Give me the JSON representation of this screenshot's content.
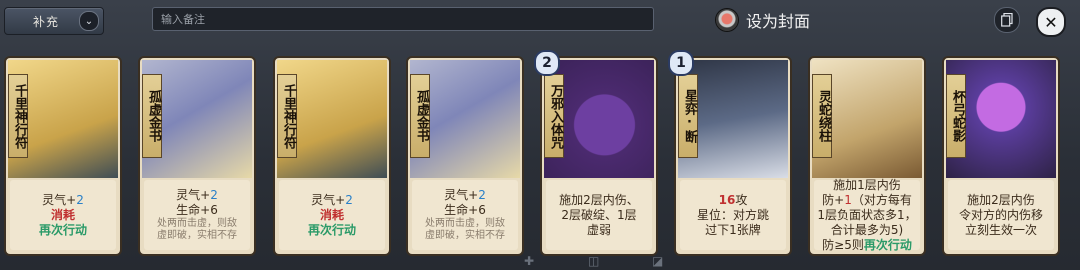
{
  "topbar": {
    "supplement_label": "补充",
    "note_placeholder": "输入备注",
    "cover_label": "设为封面"
  },
  "cards": [
    {
      "name": "千里神行符",
      "lines": [
        [
          {
            "t": "灵气+",
            "c": ""
          },
          {
            "t": "2",
            "c": "c-blue"
          }
        ],
        [
          {
            "t": "消耗",
            "c": "c-red hl"
          }
        ],
        [
          {
            "t": "再次行动",
            "c": "c-green hl"
          }
        ]
      ]
    },
    {
      "name": "孤虚金书",
      "lines": [
        [
          {
            "t": "灵气+",
            "c": ""
          },
          {
            "t": "2",
            "c": "c-blue"
          }
        ],
        [
          {
            "t": "生命+6",
            "c": ""
          }
        ],
        [
          {
            "t": "处两而击虚，则敌",
            "c": "small"
          }
        ],
        [
          {
            "t": "虚即破，实相不存",
            "c": "small"
          }
        ]
      ]
    },
    {
      "name": "千里神行符",
      "lines": [
        [
          {
            "t": "灵气+",
            "c": ""
          },
          {
            "t": "2",
            "c": "c-blue"
          }
        ],
        [
          {
            "t": "消耗",
            "c": "c-red hl"
          }
        ],
        [
          {
            "t": "再次行动",
            "c": "c-green hl"
          }
        ]
      ]
    },
    {
      "name": "孤虚金书",
      "lines": [
        [
          {
            "t": "灵气+",
            "c": ""
          },
          {
            "t": "2",
            "c": "c-blue"
          }
        ],
        [
          {
            "t": "生命+6",
            "c": ""
          }
        ],
        [
          {
            "t": "处两而击虚，则敌",
            "c": "small"
          }
        ],
        [
          {
            "t": "虚即破，实相不存",
            "c": "small"
          }
        ]
      ]
    },
    {
      "name": "万邪入体咒",
      "cost": "2",
      "lines": [
        [
          {
            "t": "施加2层内伤、",
            "c": ""
          }
        ],
        [
          {
            "t": "2层破绽、1层",
            "c": ""
          }
        ],
        [
          {
            "t": "虚弱",
            "c": ""
          }
        ]
      ]
    },
    {
      "name": "星弈·断",
      "cost": "1",
      "lines": [
        [
          {
            "t": "16",
            "c": "c-red hl"
          },
          {
            "t": "攻",
            "c": ""
          }
        ],
        [
          {
            "t": "星位：对方跳",
            "c": ""
          }
        ],
        [
          {
            "t": "过下1张牌",
            "c": ""
          }
        ]
      ]
    },
    {
      "name": "灵蛇绕柱",
      "lines": [
        [
          {
            "t": "施加1层内伤",
            "c": ""
          }
        ],
        [
          {
            "t": "防+",
            "c": ""
          },
          {
            "t": "1",
            "c": "c-red"
          },
          {
            "t": "（对方每有",
            "c": ""
          }
        ],
        [
          {
            "t": "1层负面状态多1，",
            "c": ""
          }
        ],
        [
          {
            "t": "合计最多为5)",
            "c": ""
          }
        ],
        [
          {
            "t": "防≥5则",
            "c": ""
          },
          {
            "t": "再次行动",
            "c": "c-green hl"
          }
        ]
      ]
    },
    {
      "name": "杯弓蛇影",
      "lines": [
        [
          {
            "t": "施加2层内伤",
            "c": ""
          }
        ],
        [
          {
            "t": "令对方的内伤移",
            "c": ""
          }
        ],
        [
          {
            "t": "立刻生效一次",
            "c": ""
          }
        ]
      ]
    }
  ]
}
